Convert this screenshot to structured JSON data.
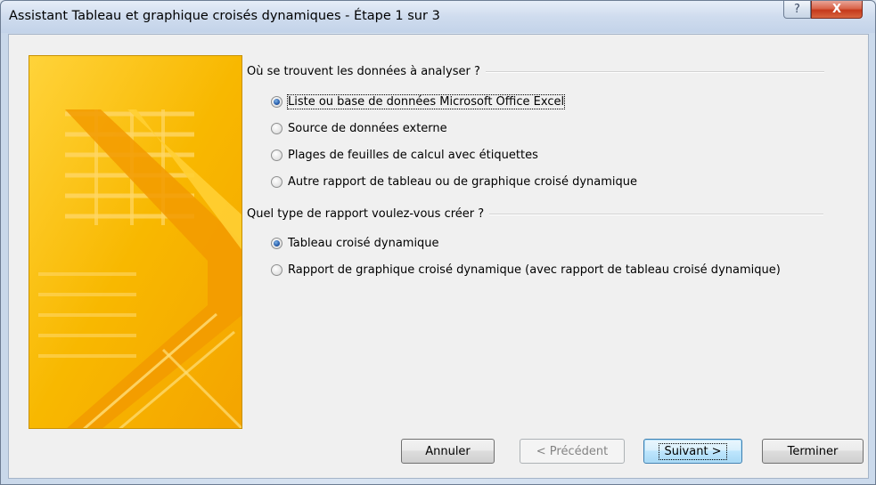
{
  "window": {
    "title": "Assistant Tableau et graphique croisés dynamiques - Étape 1 sur 3",
    "help_glyph": "?",
    "close_glyph": "X"
  },
  "section1": {
    "heading": "Où se trouvent les données à analyser ?",
    "options": [
      {
        "label": "Liste ou base de données Microsoft Office Excel",
        "checked": true
      },
      {
        "label": "Source de données externe",
        "checked": false
      },
      {
        "label": "Plages de feuilles de calcul avec étiquettes",
        "checked": false
      },
      {
        "label": "Autre rapport de tableau ou de graphique croisé dynamique",
        "checked": false
      }
    ]
  },
  "section2": {
    "heading": "Quel type de rapport voulez-vous créer ?",
    "options": [
      {
        "label": "Tableau croisé dynamique",
        "checked": true
      },
      {
        "label": "Rapport de graphique croisé dynamique (avec rapport de tableau croisé dynamique)",
        "checked": false
      }
    ]
  },
  "buttons": {
    "cancel": "Annuler",
    "previous": "< Précédent",
    "next": "Suivant >",
    "finish": "Terminer"
  },
  "colors": {
    "image_yellow": "#f8b800",
    "image_orange": "#f29a00",
    "accent_blue": "#2c62b0"
  }
}
